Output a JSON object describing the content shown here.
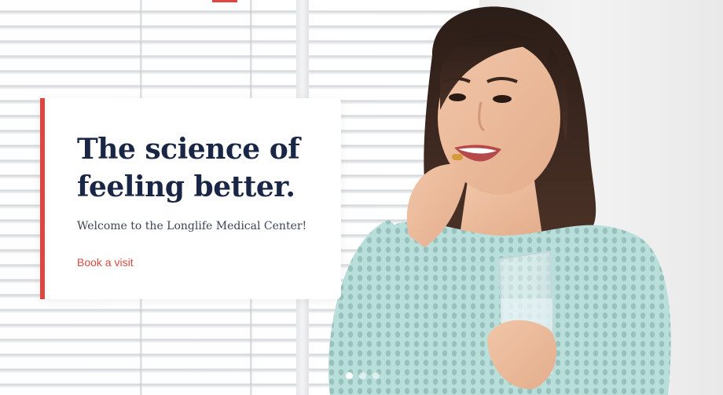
{
  "hero": {
    "headline_line1": "The science of",
    "headline_line2": "feeling better.",
    "subtitle": "Welcome to the Longlife Medical Center!",
    "cta_label": "Book a visit",
    "image_alt": "Woman taking a supplement pill with a glass of water",
    "carousel": {
      "slide_count": 3,
      "active_index": 0
    }
  },
  "colors": {
    "accent": "#e0463e",
    "headline": "#1a2645",
    "link": "#d9493f",
    "sweater": "#b7dcd8"
  }
}
